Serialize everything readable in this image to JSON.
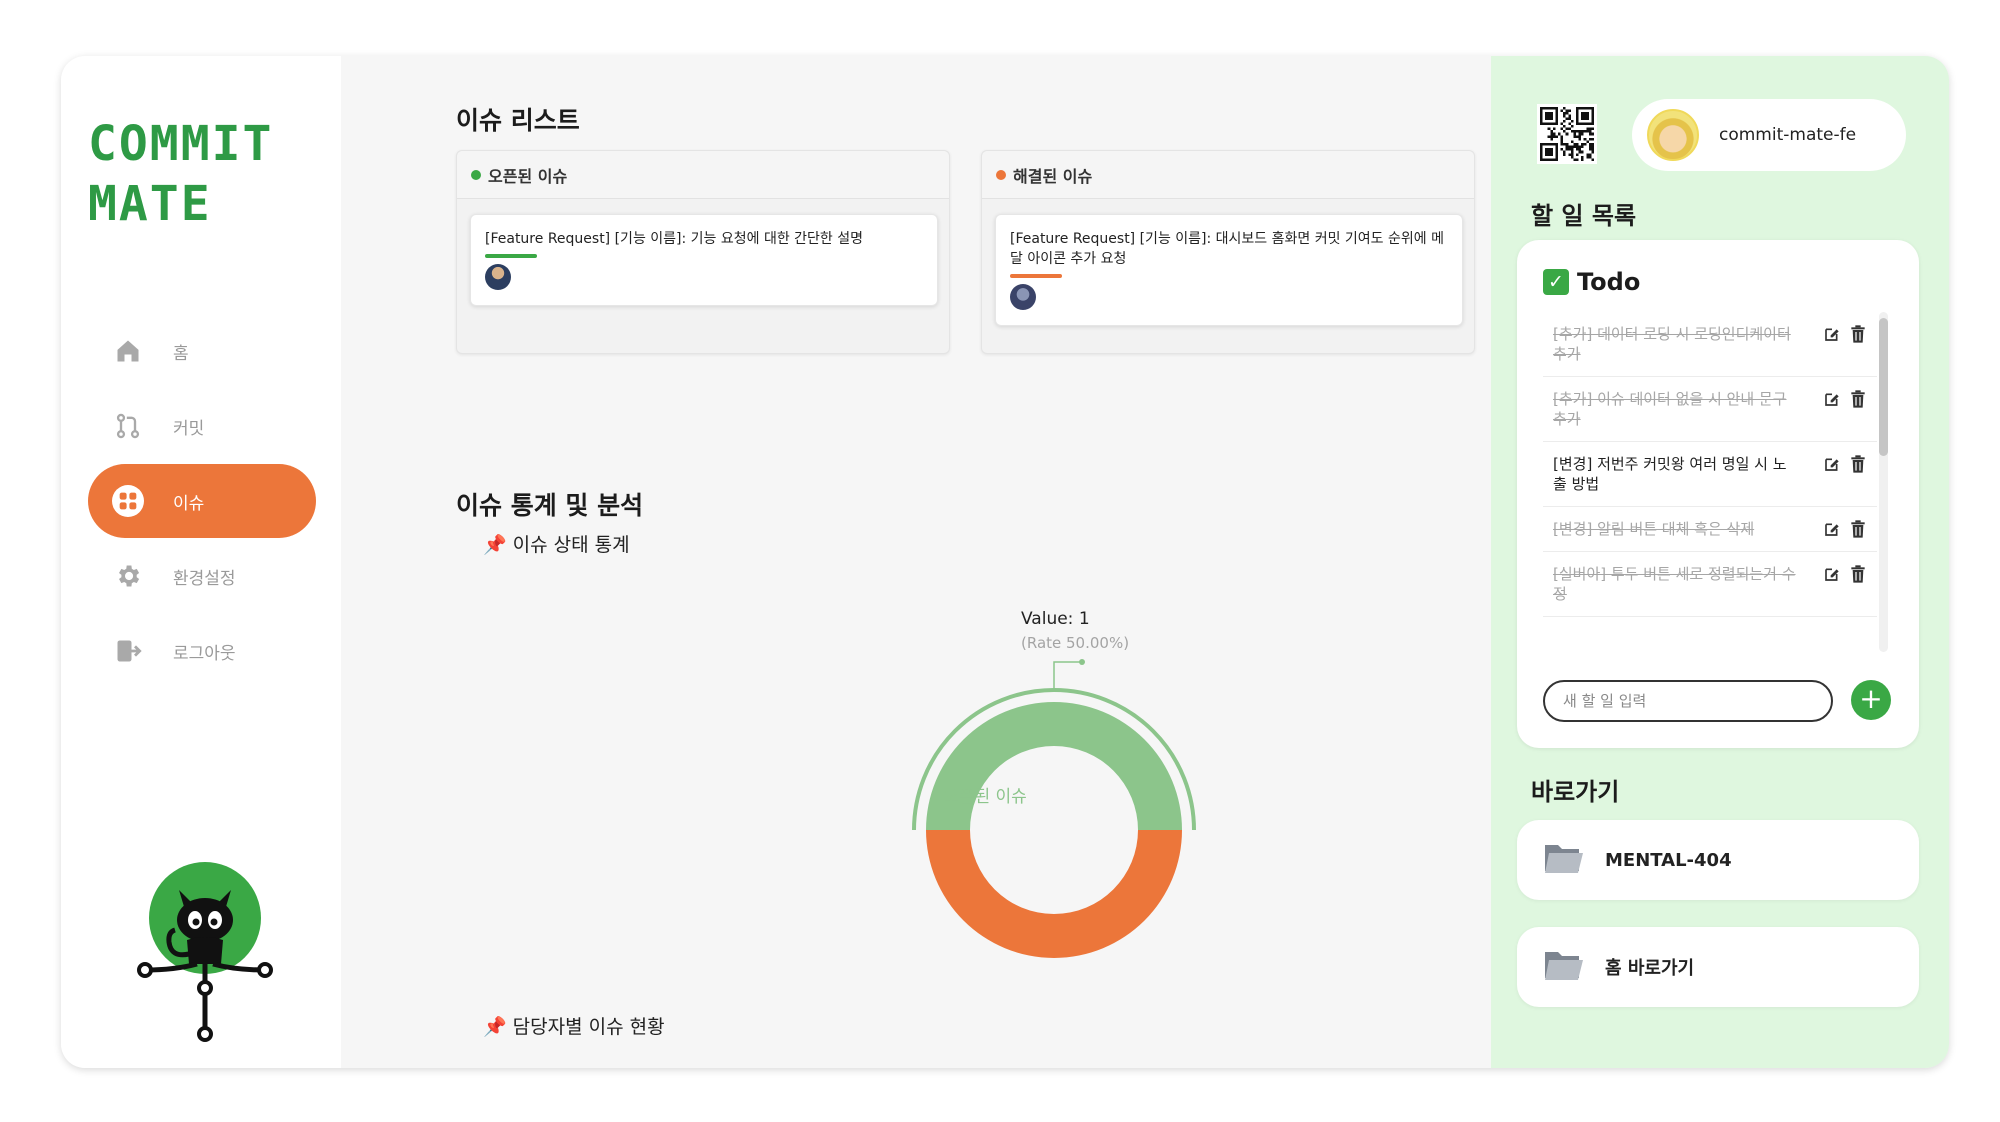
{
  "brand": {
    "line1": "COMMIT",
    "line2": "MATE",
    "color": "#2e9a45"
  },
  "nav": [
    {
      "label": "홈",
      "icon": "home-icon",
      "active": false
    },
    {
      "label": "커밋",
      "icon": "git-commit-icon",
      "active": false
    },
    {
      "label": "이슈",
      "icon": "grid-icon",
      "active": true
    },
    {
      "label": "환경설정",
      "icon": "gear-icon",
      "active": false
    },
    {
      "label": "로그아웃",
      "icon": "logout-icon",
      "active": false
    }
  ],
  "issues": {
    "title": "이슈 리스트",
    "open": {
      "header": "오픈된 이슈",
      "color": "#3aa845",
      "items": [
        {
          "text": "[Feature Request] [기능 이름]: 기능 요청에 대한 간단한 설명"
        }
      ]
    },
    "closed": {
      "header": "해결된 이슈",
      "color": "#ec763a",
      "items": [
        {
          "text": "[Feature Request] [기능 이름]: 대시보드 홈화면 커밋 기여도 순위에 메달 아이콘 추가 요청"
        }
      ]
    }
  },
  "stats": {
    "title": "이슈 통계 및 분석",
    "status_title": "이슈 상태 통계",
    "assignee_title": "담당자별 이슈 현황",
    "tooltip_value": "Value: 1",
    "tooltip_rate": "(Rate 50.00%)",
    "center_label": "오픈된 이슈"
  },
  "chart_data": {
    "type": "pie",
    "categories": [
      "오픈된 이슈",
      "해결된 이슈"
    ],
    "values": [
      1,
      1
    ],
    "colors": [
      "#8cc58b",
      "#ec763a"
    ],
    "highlighted": "오픈된 이슈"
  },
  "user": {
    "name": "commit-mate-fe"
  },
  "todo": {
    "section_title": "할 일 목록",
    "title": "Todo",
    "items": [
      {
        "text": "[추가] 데이터 로딩 시 로딩인디케이터 추가",
        "done": true
      },
      {
        "text": "[추가] 이슈 데이터 없을 시 안내 문구 추가",
        "done": true
      },
      {
        "text": "[변경] 저번주 커밋왕 여러 명일 시 노출 방법",
        "done": false
      },
      {
        "text": "[변경] 알림 버튼 대체 혹은 삭제",
        "done": true
      },
      {
        "text": "[실버아] 투두 버튼 세로 정렬되는거 수정",
        "done": true
      }
    ],
    "input_placeholder": "새 할 일 입력"
  },
  "shortcuts": {
    "title": "바로가기",
    "items": [
      {
        "label": "MENTAL-404"
      },
      {
        "label": "홈 바로가기"
      }
    ]
  }
}
